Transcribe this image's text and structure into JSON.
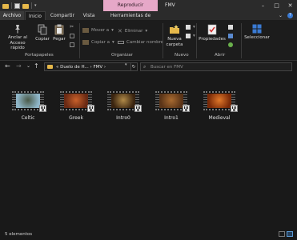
{
  "titlebar": {
    "context_tab": "Reproducir",
    "title": "FMV",
    "controls": [
      "–",
      "□",
      "✕"
    ]
  },
  "tabs": {
    "file": "Archivo",
    "home": "Inicio",
    "share": "Compartir",
    "view": "Vista",
    "video_tools": "Herramientas de vídeo",
    "collapse": "⌄",
    "help": "?"
  },
  "ribbon": {
    "clipboard": {
      "pin": "Anclar al Acceso rápido",
      "copy": "Copiar",
      "paste": "Pegar",
      "label": "Portapapeles"
    },
    "organize": {
      "move_to": "Mover a",
      "copy_to": "Copiar a",
      "delete": "Eliminar",
      "rename": "Cambiar nombre",
      "label": "Organizar"
    },
    "new": {
      "new_folder": "Nueva carpeta",
      "label": "Nuevo"
    },
    "open": {
      "properties": "Propiedades",
      "label": "Abrir"
    },
    "select": {
      "select": "Seleccionar"
    }
  },
  "navbar": {
    "back": "←",
    "forward": "→",
    "recent": "⌄",
    "up": "↑",
    "path": "«  Duelo de H...  ›  FMV  ›",
    "search_placeholder": "Buscar en FMV"
  },
  "files": [
    {
      "name": "Celtic",
      "tone_a": "#8fb6c8",
      "tone_b": "#4a5a48"
    },
    {
      "name": "Greek",
      "tone_a": "#6a2a14",
      "tone_b": "#c8602a"
    },
    {
      "name": "Intro0",
      "tone_a": "#3a2410",
      "tone_b": "#b08a48"
    },
    {
      "name": "Intro1",
      "tone_a": "#5a3418",
      "tone_b": "#a86a30"
    },
    {
      "name": "Medieval",
      "tone_a": "#7a2a08",
      "tone_b": "#e0782a"
    }
  ],
  "status": {
    "count": "5 elementos"
  }
}
